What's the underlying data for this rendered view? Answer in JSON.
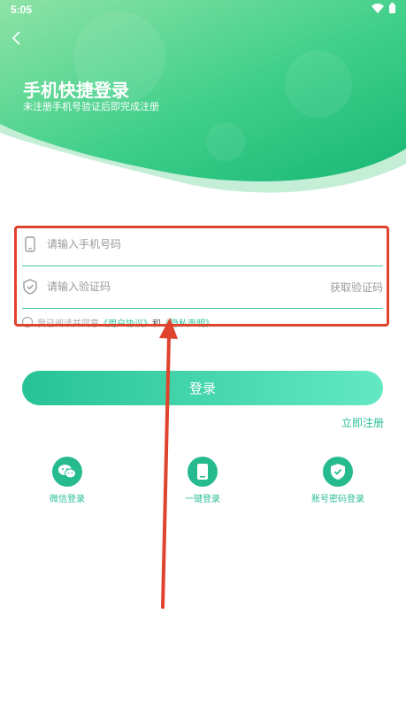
{
  "status_bar": {
    "time": "5:05",
    "wifi_icon": "wifi-icon",
    "battery_icon": "battery-icon"
  },
  "header": {
    "back_icon": "chevron-left-icon",
    "title": "手机快捷登录",
    "subtitle": "未注册手机号验证后即完成注册"
  },
  "form": {
    "phone_placeholder": "请输入手机号码",
    "code_placeholder": "请输入验证码",
    "get_code_label": "获取验证码",
    "agreement": {
      "prefix": "我已阅读并同意",
      "user_agreement": "《用户协议》",
      "and": "和",
      "privacy": "《隐私声明》"
    }
  },
  "login_button": "登录",
  "register_link": "立即注册",
  "alt_logins": [
    {
      "label": "微信登录",
      "icon": "wechat-icon"
    },
    {
      "label": "一键登录",
      "icon": "phone-icon"
    },
    {
      "label": "账号密码登录",
      "icon": "shield-check-icon"
    }
  ],
  "colors": {
    "accent": "#26bb8f",
    "highlight": "#e0432d"
  }
}
